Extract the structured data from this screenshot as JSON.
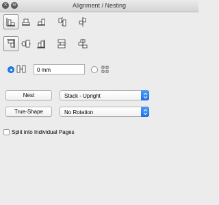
{
  "window": {
    "title": "Alignment / Nesting",
    "close_glyph": "✕",
    "minimize_glyph": "⊖"
  },
  "align_row1": [
    {
      "icon": "align-left-bottom-icon",
      "selected": true
    },
    {
      "icon": "align-center-bottom-icon",
      "selected": false
    },
    {
      "icon": "align-right-bottom-icon",
      "selected": false
    },
    {
      "icon": "distribute-horizontal-icon",
      "selected": false
    },
    {
      "icon": "distribute-offset-icon",
      "selected": false
    }
  ],
  "align_row2": [
    {
      "icon": "align-top-left-icon",
      "selected": true
    },
    {
      "icon": "align-center-vertical-icon",
      "selected": false
    },
    {
      "icon": "align-bottom-right-icon",
      "selected": false
    },
    {
      "icon": "stack-vertical-icon",
      "selected": false
    },
    {
      "icon": "stack-offset-icon",
      "selected": false
    }
  ],
  "spacing": {
    "value": "0 mm",
    "option_a_selected": true,
    "option_b_selected": false
  },
  "nest": {
    "button_label": "Nest",
    "mode_value": "Stack - Upright"
  },
  "true_shape": {
    "button_label": "True-Shape",
    "rotation_value": "No Rotation"
  },
  "split_pages": {
    "label": "Split into Individual Pages",
    "checked": false
  },
  "colors": {
    "accent": "#1f7cf2",
    "background": "#ececec"
  }
}
